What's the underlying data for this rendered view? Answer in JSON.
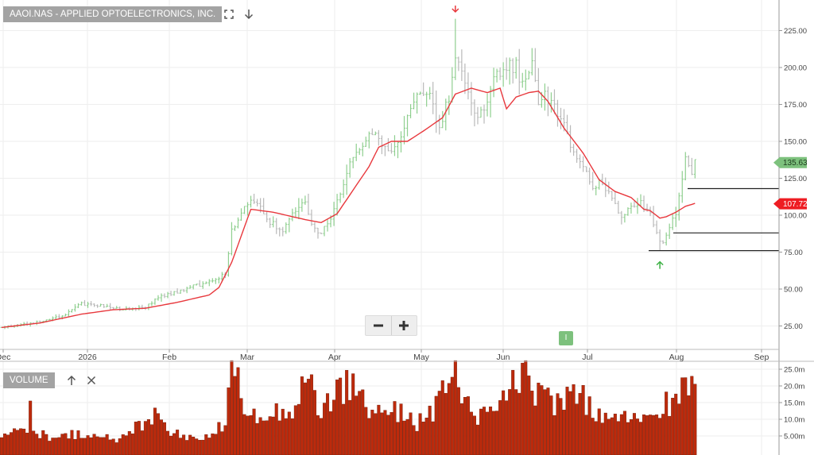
{
  "header": {
    "title": "AAOI.NAS - APPLIED OPTOELECTRONICS, INC.",
    "expand_icon": "expand-icon",
    "download_icon": "arrow-down-icon"
  },
  "zoom": {
    "minus_label": "−",
    "plus_label": "+"
  },
  "event_marker": {
    "label": "I"
  },
  "volume_panel": {
    "label": "VOLUME",
    "up_icon": "arrow-up-icon",
    "close_icon": "close-icon"
  },
  "colors": {
    "up_bar": "#8fcf8f",
    "down_bar": "#b9b9b9",
    "moving_average": "#e8383d",
    "volume_bar": "#bd2a0c",
    "last_price_tag": "#7dc17d",
    "ma_tag": "#ee1d23",
    "peak_arrow": "#e8383d",
    "trough_arrow": "#3cb043"
  },
  "chart_data": [
    {
      "type": "ohlc",
      "price_axis": {
        "ticks": [
          25,
          50,
          75,
          100,
          125,
          150,
          175,
          200,
          225
        ],
        "tick_labels": [
          "25.00",
          "50.00",
          "75.00",
          "100.00",
          "125.00",
          "150.00",
          "175.00",
          "200.00",
          "225.00"
        ]
      },
      "date_axis": {
        "labels": [
          "Dec",
          "2026",
          "Feb",
          "Mar",
          "Apr",
          "May",
          "Jun",
          "Jul",
          "Aug",
          "Sep"
        ]
      },
      "grid": true,
      "last_price": "135.63",
      "moving_average_value": "107.72",
      "horizontal_lines": [
        118,
        88,
        76
      ],
      "peak_high": 233,
      "trough_low": 76,
      "price_anchors": [
        [
          0,
          24
        ],
        [
          10,
          27
        ],
        [
          20,
          33
        ],
        [
          25,
          40
        ],
        [
          30,
          39
        ],
        [
          35,
          37
        ],
        [
          40,
          36
        ],
        [
          45,
          38
        ],
        [
          50,
          45
        ],
        [
          55,
          48
        ],
        [
          60,
          52
        ],
        [
          65,
          55
        ],
        [
          70,
          60
        ],
        [
          72,
          90
        ],
        [
          75,
          102
        ],
        [
          78,
          113
        ],
        [
          80,
          108
        ],
        [
          84,
          95
        ],
        [
          88,
          90
        ],
        [
          92,
          103
        ],
        [
          95,
          110
        ],
        [
          97,
          92
        ],
        [
          100,
          88
        ],
        [
          103,
          98
        ],
        [
          107,
          122
        ],
        [
          110,
          140
        ],
        [
          113,
          150
        ],
        [
          116,
          157
        ],
        [
          119,
          150
        ],
        [
          122,
          142
        ],
        [
          125,
          155
        ],
        [
          128,
          175
        ],
        [
          131,
          180
        ],
        [
          134,
          182
        ],
        [
          137,
          160
        ],
        [
          140,
          180
        ],
        [
          142,
          210
        ],
        [
          144,
          195
        ],
        [
          146,
          180
        ],
        [
          149,
          165
        ],
        [
          152,
          180
        ],
        [
          155,
          195
        ],
        [
          158,
          203
        ],
        [
          161,
          200
        ],
        [
          163,
          188
        ],
        [
          166,
          200
        ],
        [
          168,
          175
        ],
        [
          170,
          182
        ],
        [
          173,
          172
        ],
        [
          176,
          160
        ],
        [
          179,
          143
        ],
        [
          182,
          130
        ],
        [
          185,
          120
        ],
        [
          188,
          122
        ],
        [
          191,
          110
        ],
        [
          194,
          100
        ],
        [
          197,
          105
        ],
        [
          200,
          110
        ],
        [
          203,
          100
        ],
        [
          206,
          84
        ],
        [
          207,
          82
        ],
        [
          209,
          92
        ],
        [
          211,
          102
        ],
        [
          214,
          138
        ],
        [
          216,
          130
        ],
        [
          217,
          135.6
        ]
      ],
      "moving_average": [
        [
          0,
          24
        ],
        [
          12,
          27
        ],
        [
          25,
          33
        ],
        [
          35,
          36
        ],
        [
          45,
          37
        ],
        [
          55,
          41
        ],
        [
          65,
          46
        ],
        [
          68,
          51
        ],
        [
          72,
          68
        ],
        [
          75,
          86
        ],
        [
          78,
          104
        ],
        [
          85,
          102
        ],
        [
          95,
          97
        ],
        [
          100,
          95
        ],
        [
          105,
          101
        ],
        [
          110,
          117
        ],
        [
          115,
          133
        ],
        [
          118,
          146
        ],
        [
          122,
          150
        ],
        [
          127,
          150
        ],
        [
          132,
          157
        ],
        [
          138,
          166
        ],
        [
          142,
          182
        ],
        [
          147,
          186
        ],
        [
          152,
          183
        ],
        [
          156,
          186
        ],
        [
          158,
          172
        ],
        [
          161,
          180
        ],
        [
          165,
          183
        ],
        [
          168,
          184
        ],
        [
          171,
          177
        ],
        [
          176,
          159
        ],
        [
          182,
          142
        ],
        [
          187,
          124
        ],
        [
          192,
          116
        ],
        [
          197,
          112
        ],
        [
          201,
          104
        ],
        [
          203,
          103
        ],
        [
          206,
          98
        ],
        [
          208,
          99
        ],
        [
          211,
          102
        ],
        [
          214,
          106
        ],
        [
          217,
          108
        ]
      ]
    },
    {
      "type": "bar",
      "name": "VOLUME",
      "y_axis": {
        "ticks": [
          5,
          10,
          15,
          20,
          25
        ],
        "tick_labels": [
          "5.00m",
          "10.0m",
          "15.0m",
          "20.0m",
          "25.0m"
        ]
      },
      "anchors": [
        [
          0,
          5
        ],
        [
          8,
          8
        ],
        [
          9,
          12
        ],
        [
          10,
          7
        ],
        [
          16,
          4
        ],
        [
          20,
          5
        ],
        [
          30,
          6
        ],
        [
          36,
          3
        ],
        [
          48,
          12
        ],
        [
          51,
          11
        ],
        [
          52,
          7
        ],
        [
          60,
          4
        ],
        [
          68,
          7
        ],
        [
          70,
          8
        ],
        [
          72,
          26
        ],
        [
          73,
          28
        ],
        [
          74,
          22
        ],
        [
          75,
          13
        ],
        [
          76,
          16
        ],
        [
          80,
          12
        ],
        [
          90,
          12
        ],
        [
          95,
          22
        ],
        [
          100,
          13
        ],
        [
          105,
          18
        ],
        [
          110,
          21
        ],
        [
          112,
          17
        ],
        [
          115,
          13
        ],
        [
          120,
          11
        ],
        [
          125,
          13
        ],
        [
          130,
          9
        ],
        [
          135,
          12
        ],
        [
          138,
          21
        ],
        [
          140,
          18
        ],
        [
          142,
          22
        ],
        [
          145,
          14
        ],
        [
          150,
          11
        ],
        [
          155,
          12
        ],
        [
          160,
          20
        ],
        [
          162,
          15
        ],
        [
          164,
          27
        ],
        [
          166,
          17
        ],
        [
          170,
          20
        ],
        [
          173,
          12
        ],
        [
          176,
          17
        ],
        [
          180,
          20
        ],
        [
          185,
          12
        ],
        [
          190,
          9
        ],
        [
          195,
          10
        ],
        [
          200,
          10
        ],
        [
          205,
          11
        ],
        [
          208,
          15
        ],
        [
          211,
          15
        ],
        [
          214,
          21
        ],
        [
          215,
          15
        ],
        [
          217,
          24
        ]
      ]
    }
  ]
}
